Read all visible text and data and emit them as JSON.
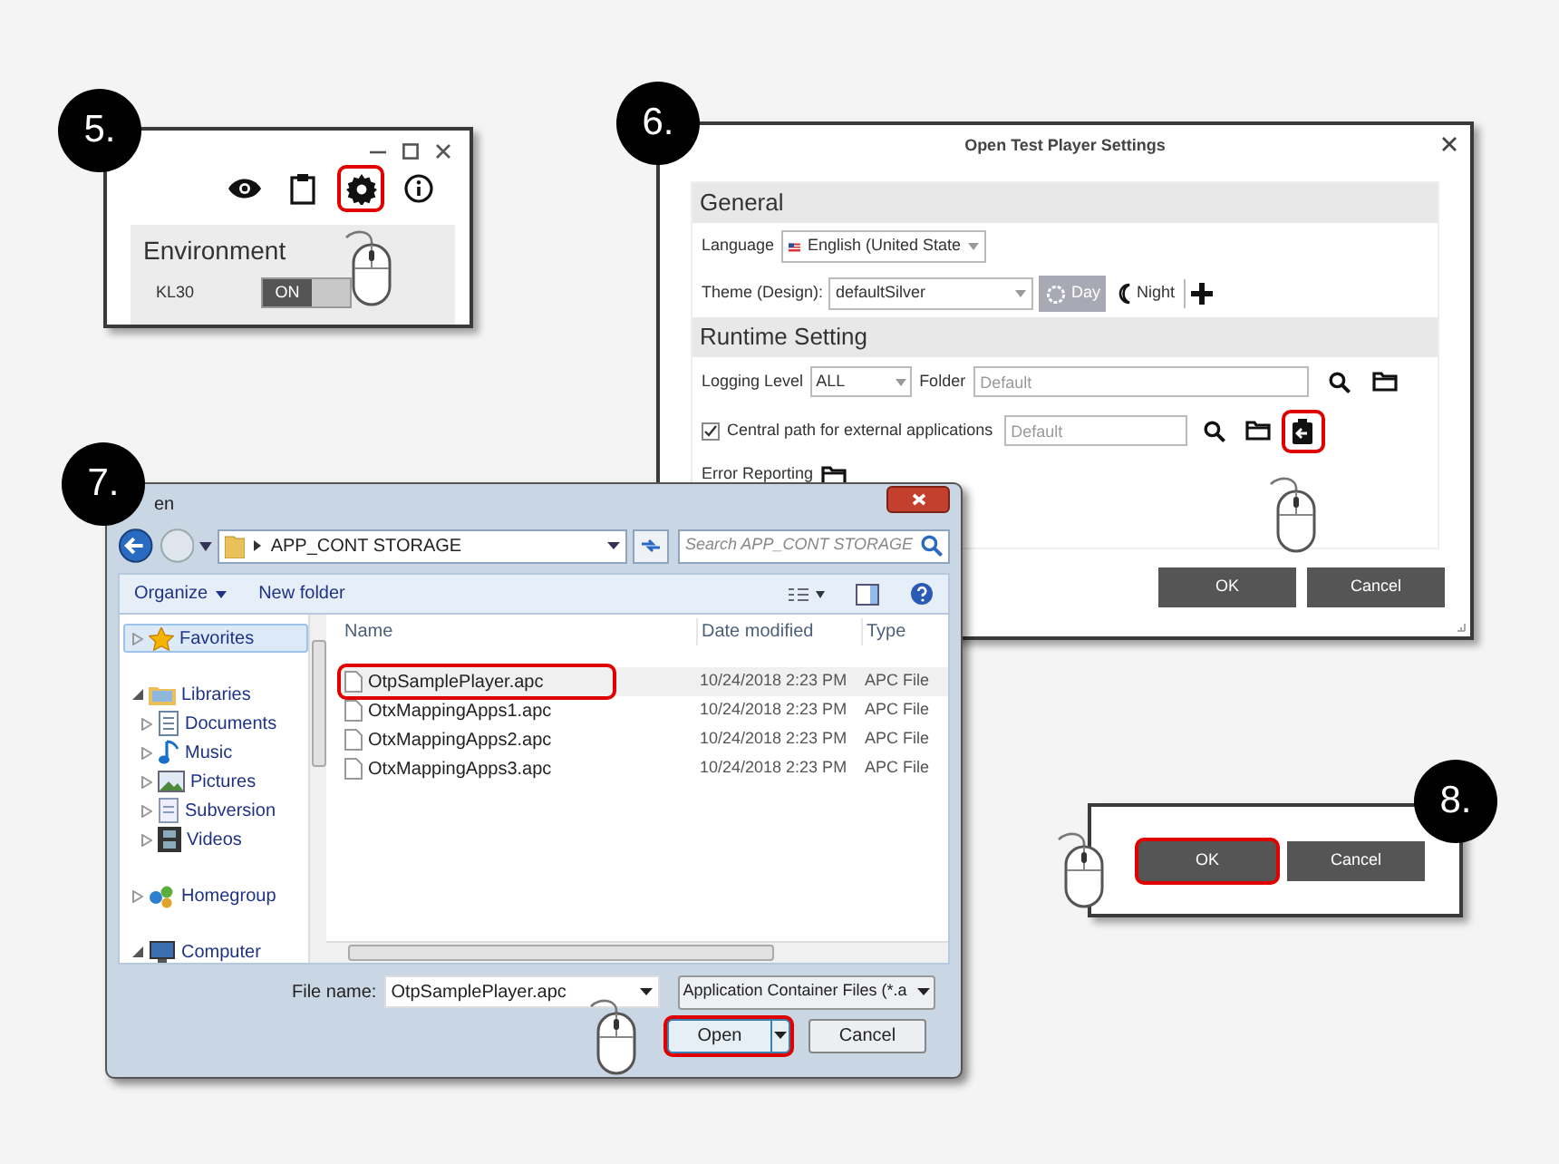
{
  "step5": {
    "badge": "5.",
    "toolbar": [
      {
        "kind": "eye",
        "highlighted": false
      },
      {
        "kind": "clipboard",
        "highlighted": false
      },
      {
        "kind": "gear",
        "highlighted": true
      },
      {
        "kind": "info",
        "highlighted": false
      }
    ],
    "environment": {
      "title": "Environment",
      "setting": {
        "label": "KL30",
        "toggle_text": "ON",
        "on": true
      }
    }
  },
  "step6": {
    "badge": "6.",
    "title": "Open Test Player Settings",
    "general": {
      "heading": "General",
      "language_label": "Language",
      "language_value": "English (United State",
      "theme_label": "Theme (Design):",
      "theme_value": "defaultSilver",
      "day_label": "Day",
      "day_selected": true,
      "night_label": "Night"
    },
    "runtime": {
      "heading": "Runtime Setting",
      "logging_label": "Logging Level",
      "logging_value": "ALL",
      "folder_label": "Folder",
      "folder_placeholder": "Default",
      "central_checked": true,
      "central_label": "Central path for external applications",
      "central_placeholder": "Default",
      "import_highlighted": true,
      "error_label": "Error Reporting"
    },
    "buttons": [
      "OK",
      "Cancel"
    ]
  },
  "step7": {
    "badge": "7.",
    "title": "en",
    "path": "APP_CONT STORAGE",
    "search_placeholder": "Search APP_CONT STORAGE",
    "organize": "Organize",
    "new_folder": "New folder",
    "nav": [
      {
        "label": "Favorites",
        "kind": "favorites",
        "expanded": false,
        "selected": true
      },
      {
        "label": "Libraries",
        "kind": "libraries",
        "expanded": true,
        "selected": false,
        "children": [
          {
            "label": "Documents",
            "kind": "documents",
            "expanded": false,
            "selected": false
          },
          {
            "label": "Music",
            "kind": "music",
            "expanded": false,
            "selected": false
          },
          {
            "label": "Pictures",
            "kind": "pictures",
            "expanded": false,
            "selected": false
          },
          {
            "label": "Subversion",
            "kind": "subversion",
            "expanded": false,
            "selected": false
          },
          {
            "label": "Videos",
            "kind": "videos",
            "expanded": false,
            "selected": false
          }
        ]
      },
      {
        "label": "Homegroup",
        "kind": "homegroup",
        "expanded": false,
        "selected": false
      },
      {
        "label": "Computer",
        "kind": "computer",
        "expanded": true,
        "selected": false
      }
    ],
    "columns": [
      "Name",
      "Date modified",
      "Type"
    ],
    "rows": [
      {
        "name": "OtpSamplePlayer.apc",
        "date": "10/24/2018 2:23 PM",
        "type": "APC File",
        "selected": true
      },
      {
        "name": "OtxMappingApps1.apc",
        "date": "10/24/2018 2:23 PM",
        "type": "APC File",
        "selected": false
      },
      {
        "name": "OtxMappingApps2.apc",
        "date": "10/24/2018 2:23 PM",
        "type": "APC File",
        "selected": false
      },
      {
        "name": "OtxMappingApps3.apc",
        "date": "10/24/2018 2:23 PM",
        "type": "APC File",
        "selected": false
      }
    ],
    "file_name_label": "File name:",
    "file_name": "OtpSamplePlayer.apc",
    "filter": "Application Container Files (*.a",
    "open_button": {
      "label": "Open",
      "highlighted": true
    },
    "cancel_button": "Cancel"
  },
  "step8": {
    "badge": "8.",
    "buttons": [
      {
        "label": "OK",
        "highlighted": true
      },
      {
        "label": "Cancel",
        "highlighted": false
      }
    ]
  }
}
